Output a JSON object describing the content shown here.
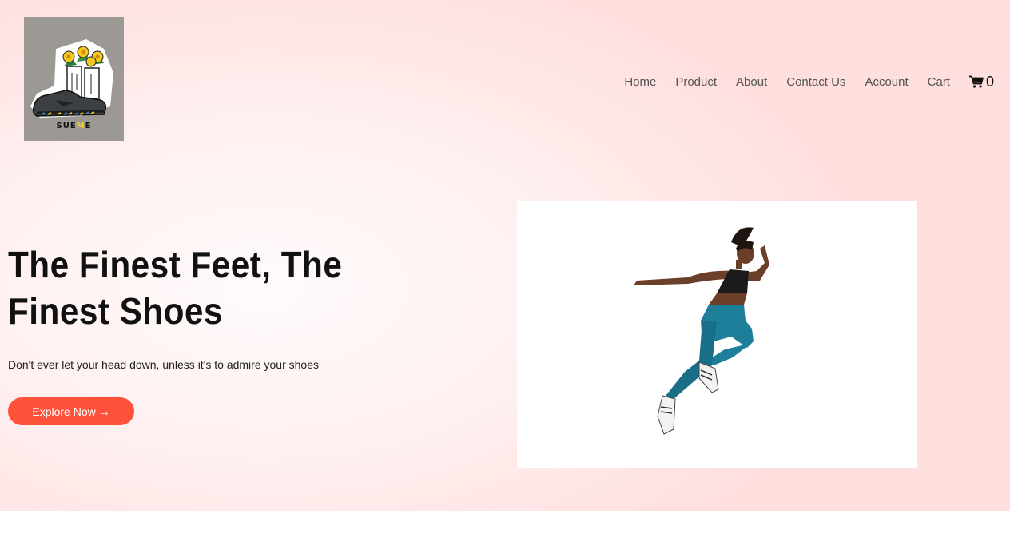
{
  "header": {
    "logo": {
      "text_main": "SUE",
      "text_accent": "M",
      "text_end": "E",
      "accent_color": "#f2d31c"
    },
    "nav": [
      {
        "label": "Home"
      },
      {
        "label": "Product"
      },
      {
        "label": "About"
      },
      {
        "label": "Contact Us"
      },
      {
        "label": "Account"
      },
      {
        "label": "Cart"
      }
    ],
    "cart": {
      "icon": "cart-icon",
      "count": "0"
    }
  },
  "hero": {
    "title": "The Finest Feet, The Finest Shoes",
    "subtitle": "Don't ever let your head down, unless it's to admire your shoes",
    "cta_label": "Explore Now →",
    "cta_color": "#ff523b",
    "image_icon": "running-woman-illustration"
  },
  "colors": {
    "hero_bg": "#ffdede",
    "text_dark": "#111111",
    "nav_text": "#555555"
  }
}
